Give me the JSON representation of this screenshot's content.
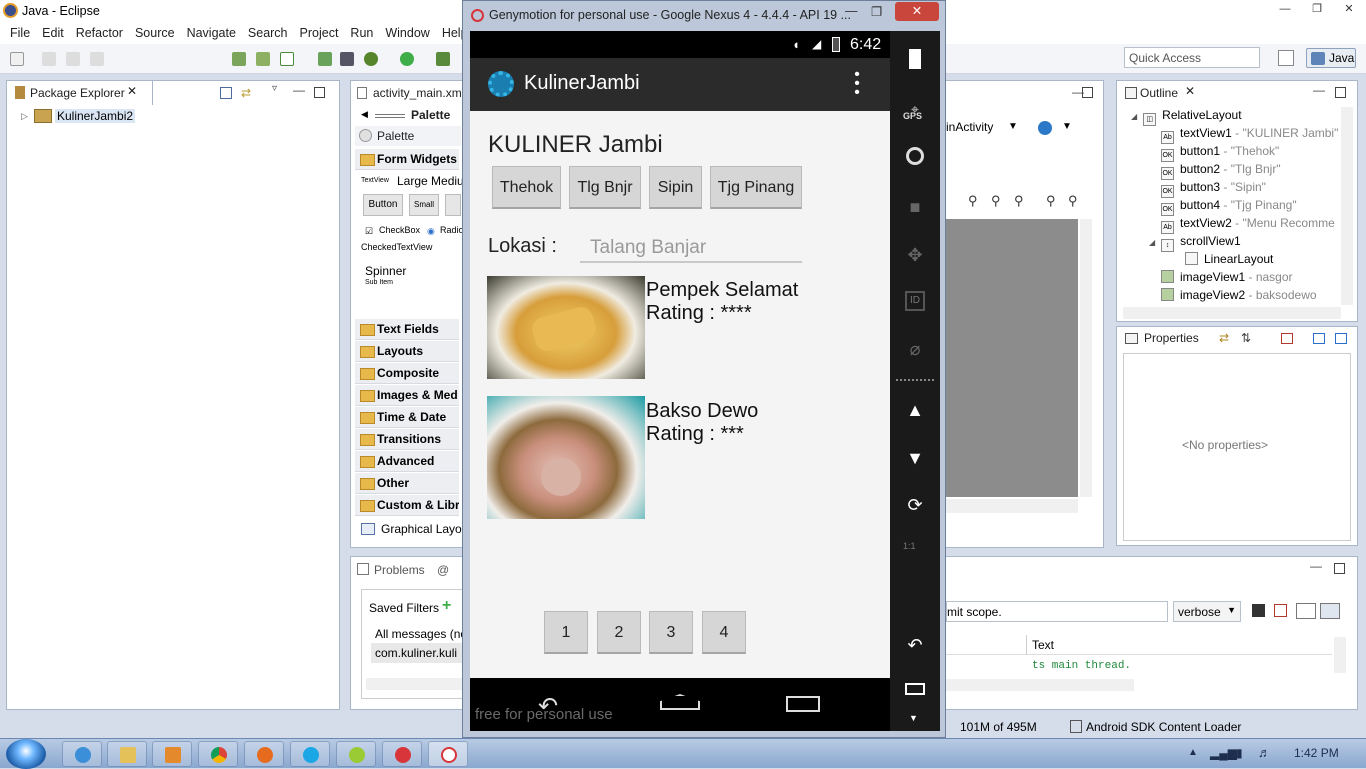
{
  "eclipse": {
    "title": "Java - Eclipse",
    "menu": [
      "File",
      "Edit",
      "Refactor",
      "Source",
      "Navigate",
      "Search",
      "Project",
      "Run",
      "Window",
      "Help"
    ],
    "quick_access_placeholder": "Quick Access",
    "perspective": "Java"
  },
  "package_explorer": {
    "tab": "Package Explorer",
    "project": "KulinerJambi2"
  },
  "editor": {
    "tab": "activity_main.xml",
    "palette_header": "Palette",
    "palette_title": "Palette",
    "form_widgets": "Form Widgets",
    "textview_label": "TextView",
    "large_medium": "Large Mediu",
    "button": "Button",
    "small": "Small",
    "checkbox": "CheckBox",
    "radio": "Radio",
    "checked_textview": "CheckedTextView",
    "spinner": "Spinner",
    "sub_item": "Sub Item",
    "categories": [
      "Text Fields",
      "Layouts",
      "Composite",
      "Images & Med",
      "Time & Date",
      "Transitions",
      "Advanced",
      "Other",
      "Custom & Libr"
    ],
    "graphical_layout": "Graphical Layou",
    "activity_dropdown": "inActivity"
  },
  "outline": {
    "tab": "Outline",
    "root": "RelativeLayout",
    "items": [
      {
        "name": "textView1",
        "detail": " - \"KULINER Jambi\"",
        "icon": "Ab"
      },
      {
        "name": "button1",
        "detail": " - \"Thehok\"",
        "icon": "OK"
      },
      {
        "name": "button2",
        "detail": " - \"Tlg Bnjr\"",
        "icon": "OK"
      },
      {
        "name": "button3",
        "detail": " - \"Sipin\"",
        "icon": "OK"
      },
      {
        "name": "button4",
        "detail": " - \"Tjg Pinang\"",
        "icon": "OK"
      },
      {
        "name": "textView2",
        "detail": " - \"Menu Recomme",
        "icon": "Ab"
      }
    ],
    "scroll_view": "scrollView1",
    "linear_layout": "LinearLayout",
    "images": [
      {
        "name": "imageView1",
        "detail": " - nasgor"
      },
      {
        "name": "imageView2",
        "detail": " - baksodewo"
      }
    ]
  },
  "properties": {
    "tab": "Properties",
    "empty": "<No properties>"
  },
  "problems": {
    "tab": "Problems",
    "saved_filters": "Saved Filters",
    "all_messages": "All messages (no",
    "filter_item": "com.kuliner.kuli",
    "scope_hint": "mit scope.",
    "verbose": "verbose",
    "text_col": "Text",
    "log_line": "ts main thread."
  },
  "status": {
    "memory": "101M of 495M",
    "loader": "Android SDK Content Loader"
  },
  "genymotion": {
    "title": "Genymotion for personal use - Google Nexus 4 - 4.4.4 - API 19 ...",
    "time": "6:42",
    "app_title": "KulinerJambi",
    "heading": "KULINER Jambi",
    "buttons": [
      "Thehok",
      "Tlg Bnjr",
      "Sipin",
      "Tjg Pinang"
    ],
    "lokasi_label": "Lokasi :",
    "lokasi_hint": "Talang Banjar",
    "items": [
      {
        "name": "Pempek Selamat",
        "rating": "Rating : ****"
      },
      {
        "name": "Bakso Dewo",
        "rating": "Rating : ***"
      }
    ],
    "pages": [
      "1",
      "2",
      "3",
      "4"
    ],
    "watermark": "free for personal use",
    "gps_label": "GPS",
    "id_label": "ID",
    "scale_label": "1:1"
  },
  "taskbar": {
    "time": "1:42 PM"
  },
  "colors": {
    "actionbar": "#2b2b2b",
    "app_bg": "#f4f4f4",
    "button_bg": "#d6d6d6",
    "holo_blue": "#33b5e5",
    "accent_green": "#3fae49"
  }
}
